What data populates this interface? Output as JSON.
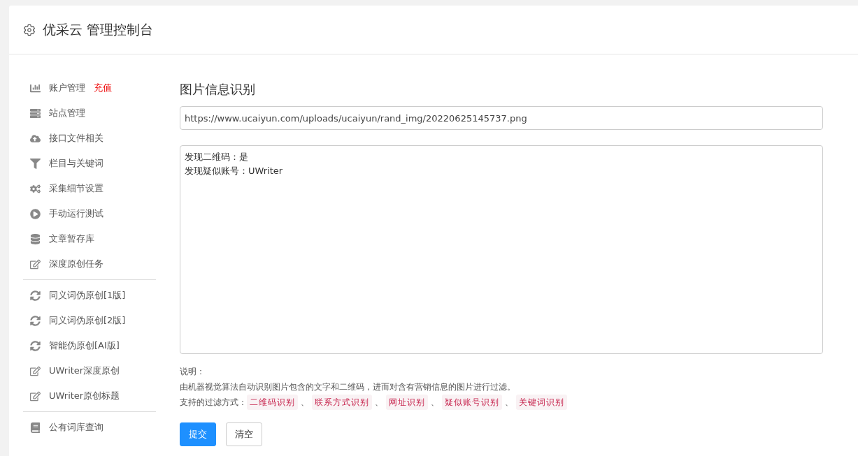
{
  "header": {
    "title": "优采云 管理控制台"
  },
  "sidebar": {
    "groups": [
      {
        "items": [
          {
            "kind": "chart",
            "label": "账户管理",
            "badge": "充值",
            "selected": false
          },
          {
            "kind": "server",
            "label": "站点管理",
            "selected": false
          },
          {
            "kind": "cloud",
            "label": "接口文件相关",
            "selected": false
          },
          {
            "kind": "filter",
            "label": "栏目与关键词",
            "selected": false
          },
          {
            "kind": "cogs",
            "label": "采集细节设置",
            "selected": false
          },
          {
            "kind": "play",
            "label": "手动运行测试",
            "selected": false
          },
          {
            "kind": "database",
            "label": "文章暂存库",
            "selected": false
          },
          {
            "kind": "edit",
            "label": "深度原创任务",
            "selected": false
          }
        ]
      },
      {
        "items": [
          {
            "kind": "refresh",
            "label": "同义词伪原创[1版]",
            "selected": false
          },
          {
            "kind": "refresh",
            "label": "同义词伪原创[2版]",
            "selected": false
          },
          {
            "kind": "refresh",
            "label": "智能伪原创[AI版]",
            "selected": false
          },
          {
            "kind": "edit",
            "label": "UWriter深度原创",
            "selected": false
          },
          {
            "kind": "edit",
            "label": "UWriter原创标题",
            "selected": false
          }
        ]
      },
      {
        "items": [
          {
            "kind": "book",
            "label": "公有词库查询",
            "selected": false
          }
        ]
      }
    ]
  },
  "main": {
    "title": "图片信息识别",
    "url_field": {
      "value": "https://www.ucaiyun.com/uploads/ucaiyun/rand_img/20220625145737.png"
    },
    "result_box": {
      "lines": [
        "发现二维码：是",
        "发现疑似账号：UWriter"
      ]
    },
    "notes": {
      "heading": "说明：",
      "description": "由机器视觉算法自动识别图片包含的文字和二维码，进而对含有营销信息的图片进行过滤。",
      "methods_label": "支持的过滤方式：",
      "separator": "、",
      "methods": [
        "二维码识别",
        "联系方式识别",
        "网址识别",
        "疑似账号识别",
        "关键词识别"
      ]
    },
    "buttons": [
      {
        "kind": "primary",
        "label": "提交"
      },
      {
        "kind": "default",
        "label": "清空"
      }
    ]
  }
}
